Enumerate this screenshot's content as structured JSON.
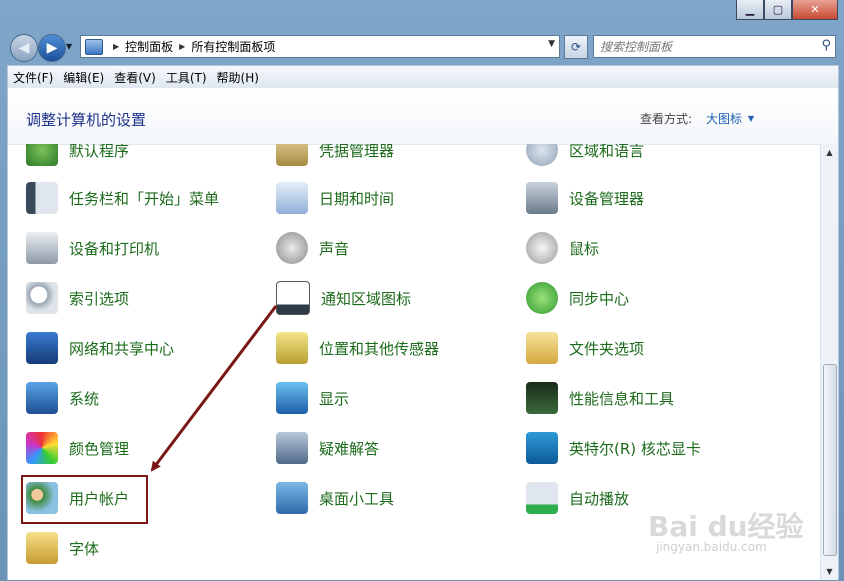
{
  "address": {
    "crumbs": [
      "控制面板",
      "所有控制面板项"
    ]
  },
  "search": {
    "placeholder": "搜索控制面板"
  },
  "menu": [
    "文件(F)",
    "编辑(E)",
    "查看(V)",
    "工具(T)",
    "帮助(H)"
  ],
  "header": {
    "title": "调整计算机的设置",
    "view_by": "查看方式:",
    "view_value": "大图标"
  },
  "items": [
    {
      "label": "默认程序",
      "icon": "default-programs-icon"
    },
    {
      "label": "凭据管理器",
      "icon": "credential-manager-icon"
    },
    {
      "label": "区域和语言",
      "icon": "region-language-icon"
    },
    {
      "label": "任务栏和「开始」菜单",
      "icon": "taskbar-icon"
    },
    {
      "label": "日期和时间",
      "icon": "date-time-icon"
    },
    {
      "label": "设备管理器",
      "icon": "device-manager-icon"
    },
    {
      "label": "设备和打印机",
      "icon": "printer-icon"
    },
    {
      "label": "声音",
      "icon": "speaker-icon"
    },
    {
      "label": "鼠标",
      "icon": "mouse-icon"
    },
    {
      "label": "索引选项",
      "icon": "index-search-icon"
    },
    {
      "label": "通知区域图标",
      "icon": "notification-area-icon"
    },
    {
      "label": "同步中心",
      "icon": "sync-icon"
    },
    {
      "label": "网络和共享中心",
      "icon": "network-icon"
    },
    {
      "label": "位置和其他传感器",
      "icon": "location-sensor-icon"
    },
    {
      "label": "文件夹选项",
      "icon": "folder-options-icon"
    },
    {
      "label": "系统",
      "icon": "system-icon"
    },
    {
      "label": "显示",
      "icon": "display-icon"
    },
    {
      "label": "性能信息和工具",
      "icon": "performance-icon"
    },
    {
      "label": "颜色管理",
      "icon": "color-management-icon"
    },
    {
      "label": "疑难解答",
      "icon": "troubleshooting-icon"
    },
    {
      "label": "英特尔(R) 核芯显卡",
      "icon": "intel-graphics-icon"
    },
    {
      "label": "用户帐户",
      "icon": "user-accounts-icon"
    },
    {
      "label": "桌面小工具",
      "icon": "gadgets-icon"
    },
    {
      "label": "自动播放",
      "icon": "autoplay-icon"
    },
    {
      "label": "字体",
      "icon": "fonts-icon"
    }
  ],
  "watermark": {
    "brand": "Bai du经验",
    "url": "jingyan.baidu.com"
  },
  "colors": {
    "link_green": "#1c6b1c",
    "title_blue": "#1e3287",
    "highlight": "#7a1616"
  }
}
